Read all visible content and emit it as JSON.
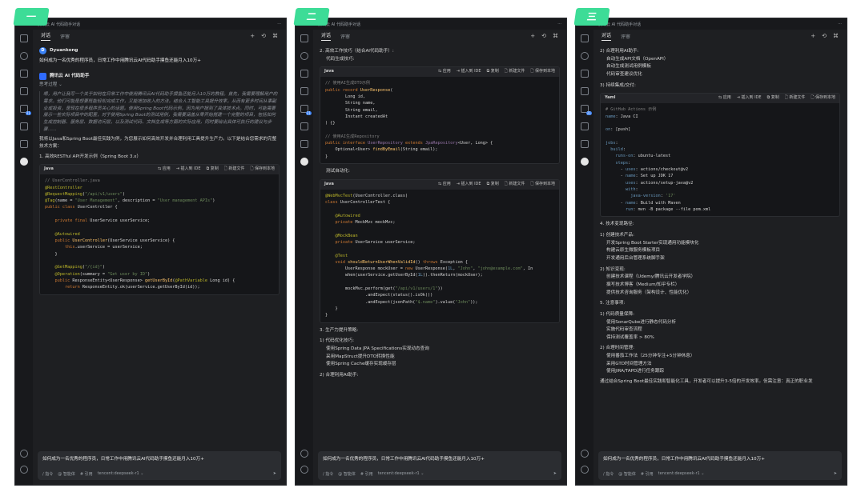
{
  "tags": [
    "一",
    "二",
    "三"
  ],
  "window_title": "腾讯云 AI 代码助手对话",
  "tabs": {
    "chat": "对话",
    "review": "评审"
  },
  "toolbar": {
    "new": "+",
    "history": "⟲",
    "more": "⌘"
  },
  "p1": {
    "user_initial": "D",
    "user_name": "Dyuankong",
    "question": "如何成为一名优秀的程序员，日常工作中用腾讯云AI代码助手摸鱼还能月入10万+",
    "bot_name": "腾讯云 AI 代码助手",
    "think_label": "思考过程 ⌄",
    "reasoning": "嗯，用户让我写一个关于如何在日常工作中使用腾讯云AI代码助手摸鱼还能月入10万的教程。首先，我需要理解用户的需求。他们可能是想要既能轻松完成工作，又能增加收入的方法。结合人工智能工具提升效率，从而有更多时间从事副业或投资，是现在很多程序员关心的话题。使用Spring Boot代码示例，因为用户提到了具体技术点。同时，可能需要展示一些实际项目中的配置，对于使用Spring Boot的测试用例，我需要涵盖从零开始搭建一个完整的项目，包括如何生成控制器、服务层、数据访问层，以及测试代码、文档生成等方面的实际应用，同时要给出具体可执行的建议与步骤……",
    "intro": "我将以Java和Spring Boot最佳实践为例，为您展示如何高效开发并合理利用工具提升生产力。以下是结合您需求的完整技术方案：",
    "section1": "1. 高效RESTful API开发示例（Spring Boot 3.x）",
    "code_lang": "Java",
    "code_actions": [
      "⇆ 应用",
      "⇥ 插入到 IDE",
      "⧉ 复制",
      "🗋 新建文件",
      "🗋 保存到本地"
    ],
    "input": "如何成为一名优秀的程序员，日常工作中用腾讯云AI代码助手摸鱼还能月入10万+",
    "input_bar": [
      "/ 指令",
      "@ 智能体",
      "# 引用",
      "tencent:deepseek-r1 ⌄"
    ]
  },
  "p2": {
    "h1": "2. 高效工作技巧（结合AI代码助手）:",
    "b1": "代码生成技巧:",
    "b2": "测试自动化:",
    "h3": "3. 生产力提升策略:",
    "h3_1": "1) 代码优化技巧:",
    "list1": [
      "使用Spring Data JPA Specifications实现动态查询",
      "采用MapStruct提升DTO转换性能",
      "使用Spring Cache缓存实现缓存层"
    ],
    "h3_2": "2) 合理利用AI助手:"
  },
  "p3": {
    "h_ai": "2) 合理利用AI助手:",
    "ai_list": [
      "自动生成API文档（OpenAPI）",
      "自动生成测试用例模板",
      "代码审查建议优化"
    ],
    "h_ci": "3) 持续集成/交付:",
    "code_lang": "Yaml",
    "h4": "4. 技术变现路径:",
    "h4_1": "1) 创建技术产品:",
    "list4_1": [
      "开发Spring Boot Starter实现通用功能模块化",
      "构建云原生微服务模板项目",
      "开发通用后台管理系统脚手架"
    ],
    "h4_2": "2) 知识变现:",
    "list4_2": [
      "创建技术课程（Udemy/腾讯云开发者学院）",
      "撰写技术博客（Medium/知乎专栏）",
      "提供技术咨询服务（架构设计、性能优化）"
    ],
    "h5": "5. 注意事项:",
    "h5_1": "1) 代码质量保障:",
    "list5_1": [
      "使用SonarQube进行静态代码分析",
      "实施代码审查流程",
      "保持测试覆盖率 > 80%"
    ],
    "h5_2": "2) 合理时间管理:",
    "list5_2": [
      "使用番茄工作法（25分钟专注+5分钟休息）",
      "采用GTD时间管理方法",
      "使用JIRA/TAPD进行任务跟踪"
    ],
    "closing": "通过结合Spring Boot最佳实践和智能化工具，开发者可以提升3-5倍的开发效率。但需注意：真正的职业发"
  }
}
